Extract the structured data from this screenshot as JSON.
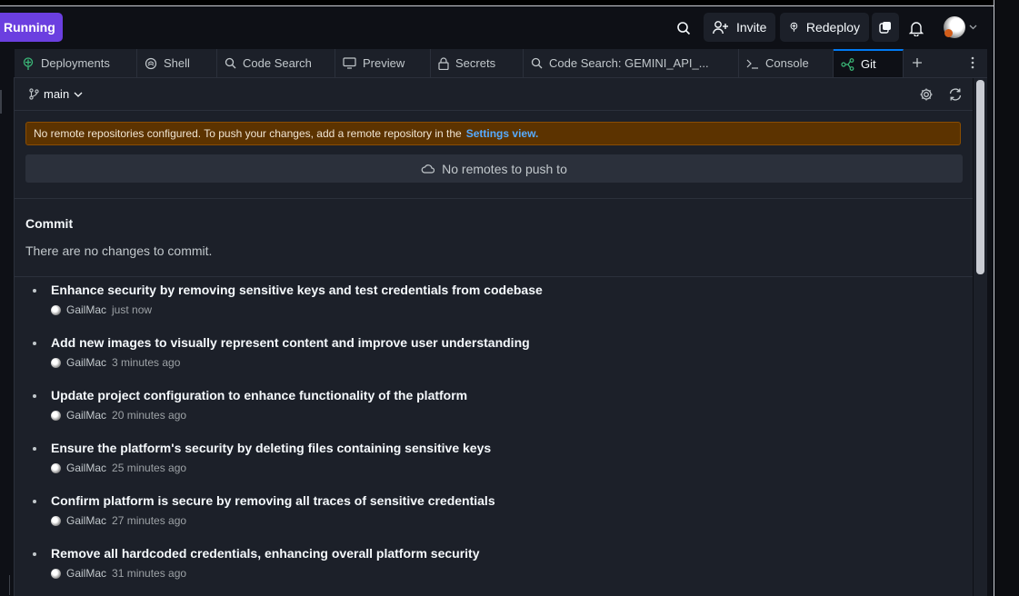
{
  "topbar": {
    "status": "Running",
    "invite": "Invite",
    "redeploy": "Redeploy"
  },
  "tabs": [
    {
      "label": "Deployments",
      "icon": "deployments-icon"
    },
    {
      "label": "Shell",
      "icon": "shell-icon"
    },
    {
      "label": "Code Search",
      "icon": "search-icon"
    },
    {
      "label": "Preview",
      "icon": "preview-icon"
    },
    {
      "label": "Secrets",
      "icon": "lock-icon"
    },
    {
      "label": "Code Search: GEMINI_API_...",
      "icon": "search-icon"
    },
    {
      "label": "Console",
      "icon": "console-icon"
    },
    {
      "label": "Git",
      "icon": "git-icon"
    }
  ],
  "git": {
    "branch": "main",
    "warning_text": "No remote repositories configured. To push your changes, add a remote repository in the",
    "warning_link": "Settings view.",
    "no_remotes": "No remotes to push to",
    "commit_heading": "Commit",
    "commit_empty": "There are no changes to commit.",
    "commits": [
      {
        "message": "Enhance security by removing sensitive keys and test credentials from codebase",
        "author": "GailMac",
        "time": "just now"
      },
      {
        "message": "Add new images to visually represent content and improve user understanding",
        "author": "GailMac",
        "time": "3 minutes ago"
      },
      {
        "message": "Update project configuration to enhance functionality of the platform",
        "author": "GailMac",
        "time": "20 minutes ago"
      },
      {
        "message": "Ensure the platform's security by deleting files containing sensitive keys",
        "author": "GailMac",
        "time": "25 minutes ago"
      },
      {
        "message": "Confirm platform is secure by removing all traces of sensitive credentials",
        "author": "GailMac",
        "time": "27 minutes ago"
      },
      {
        "message": "Remove all hardcoded credentials, enhancing overall platform security",
        "author": "GailMac",
        "time": "31 minutes ago"
      }
    ]
  }
}
